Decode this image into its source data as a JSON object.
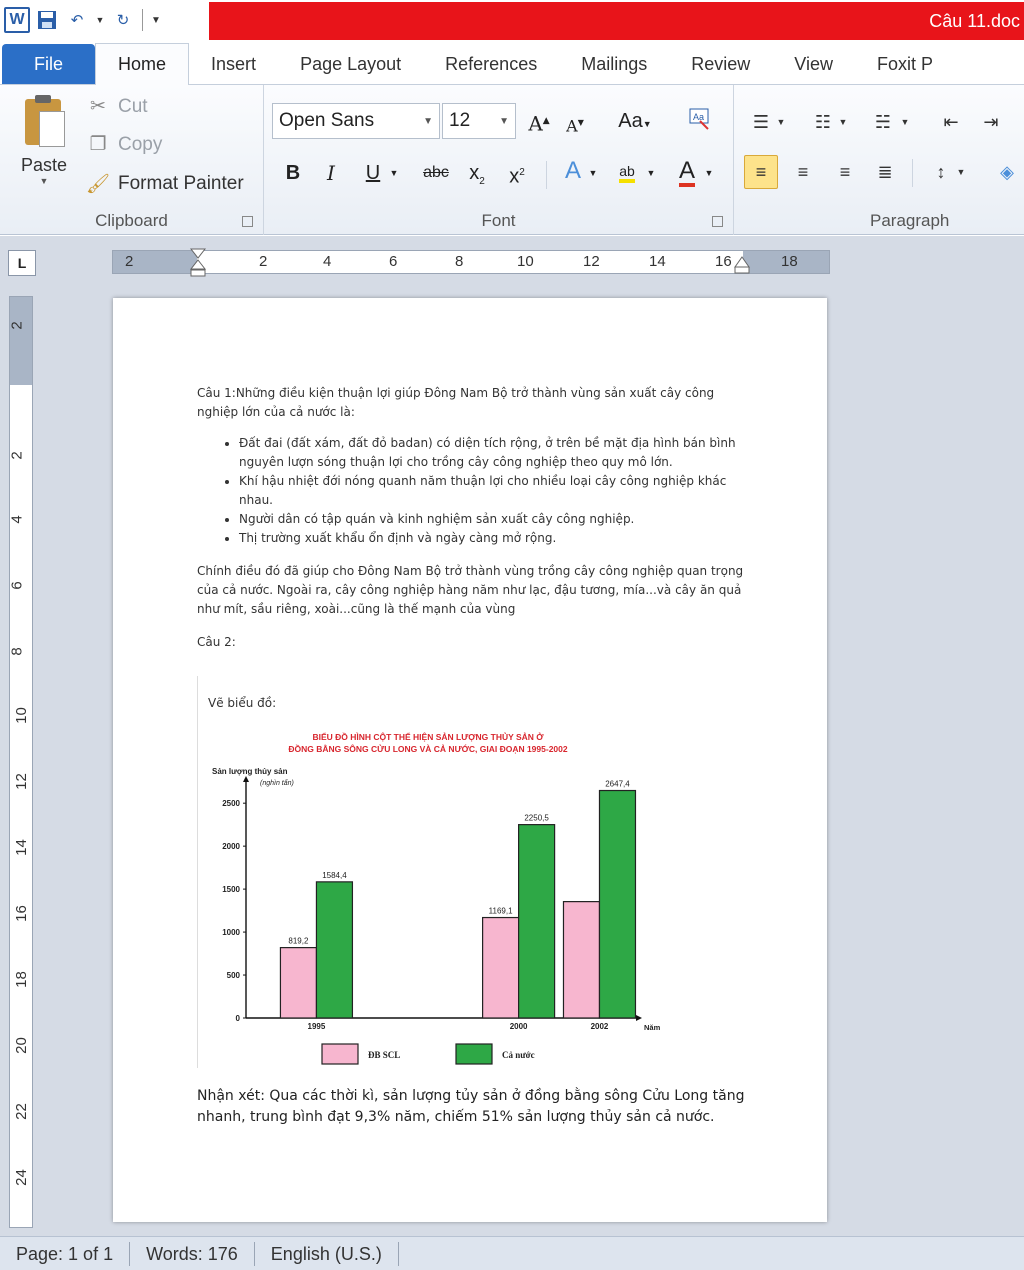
{
  "window": {
    "title": "Câu 11.doc",
    "qat_buttons": [
      "save-icon",
      "undo-icon",
      "redo-icon",
      "customize-icon"
    ]
  },
  "tabs": [
    {
      "label": "File"
    },
    {
      "label": "Home"
    },
    {
      "label": "Insert"
    },
    {
      "label": "Page Layout"
    },
    {
      "label": "References"
    },
    {
      "label": "Mailings"
    },
    {
      "label": "Review"
    },
    {
      "label": "View"
    },
    {
      "label": "Foxit P"
    }
  ],
  "ribbon": {
    "clipboard": {
      "label": "Clipboard",
      "paste": "Paste",
      "cut": "Cut",
      "copy": "Copy",
      "format_painter": "Format Painter"
    },
    "font": {
      "label": "Font",
      "font_name": "Open Sans",
      "font_size": "12"
    },
    "paragraph": {
      "label": "Paragraph"
    }
  },
  "ruler": {
    "h_numbers": [
      "2",
      "2",
      "4",
      "6",
      "8",
      "10",
      "12",
      "14",
      "16",
      "18"
    ],
    "v_numbers": [
      "2",
      "2",
      "4",
      "6",
      "8",
      "10",
      "12",
      "14",
      "16",
      "18",
      "20",
      "22",
      "24"
    ]
  },
  "document": {
    "q1_intro": "Câu 1:Những điều kiện thuận lợi giúp Đông Nam Bộ trở thành vùng sản xuất cây công nghiệp lớn của cả nước là:",
    "bullets": [
      "Đất đai (đất xám, đất đỏ badan) có diện tích rộng, ở trên bề mặt địa hình bán bình nguyên lượn sóng thuận lợi cho trồng cây công nghiệp theo quy mô lớn.",
      "Khí hậu nhiệt đới nóng quanh năm thuận lợi cho nhiều loại cây công nghiệp khác nhau.",
      "Người dân có tập quán và kinh nghiệm sản xuất cây công nghiệp.",
      "Thị trường xuất khẩu ổn định và ngày càng mở rộng."
    ],
    "q1_conclusion": "Chính điều đó đã giúp cho Đông Nam Bộ trở thành vùng trồng cây công nghiệp quan trọng của cả nước. Ngoài ra, cây công nghiệp hàng năm như lạc, đậu tương, mía...và cây ăn quả như mít, sầu riêng, xoài...cũng là thế mạnh của vùng",
    "q2_label": "Câu 2:",
    "chart_intro": "Vẽ biểu đồ:",
    "remark": "Nhận xét: Qua các thời kì, sản lượng tủy sản ở đồng bằng sông Cửu Long tăng nhanh, trung bình đạt 9,3% năm, chiếm 51% sản lượng thủy sản cả nước."
  },
  "chart_data": {
    "type": "bar",
    "title": "BIỂU ĐỒ HÌNH CỘT THỂ HIỆN SẢN LƯỢNG THỦY SẢN Ở ĐỒNG BẰNG SÔNG CỬU LONG VÀ CẢ NƯỚC, GIAI ĐOẠN 1995-2002",
    "title_lines": [
      "BIỂU ĐỒ HÌNH CỘT THỂ HIỆN SẢN LƯỢNG THỦY SẢN Ở",
      "ĐỒNG BẰNG SÔNG CỬU LONG VÀ CẢ NƯỚC, GIAI ĐOẠN 1995-2002"
    ],
    "ylabel": "Sản lượng thủy sản",
    "ylabel_unit": "(nghìn tấn)",
    "xlabel": "Năm",
    "categories": [
      "1995",
      "2000",
      "2002"
    ],
    "x": [
      1995,
      2000,
      2002
    ],
    "ylim": [
      0,
      2700
    ],
    "yticks": [
      "0",
      "500",
      "1000",
      "1500",
      "2000",
      "2500"
    ],
    "series": [
      {
        "name": "ĐB SCL",
        "values": [
          819.2,
          1169.1,
          1354.5
        ],
        "labels": [
          "819,2",
          "1169,1",
          ""
        ],
        "color": "#f7b6cf"
      },
      {
        "name": "Cả nước",
        "values": [
          1584.4,
          2250.5,
          2647.4
        ],
        "labels": [
          "1584,4",
          "2250,5",
          "2647,4"
        ],
        "color": "#2ea846"
      }
    ],
    "title_color": "#d8262e",
    "legend_position": "bottom"
  },
  "statusbar": {
    "page": "Page: 1 of 1",
    "words": "Words: 176",
    "language": "English (U.S.)"
  },
  "colors": {
    "title_bar": "#e8141a",
    "file_tab": "#2b6fc7",
    "active_highlight": "#fde38b"
  }
}
